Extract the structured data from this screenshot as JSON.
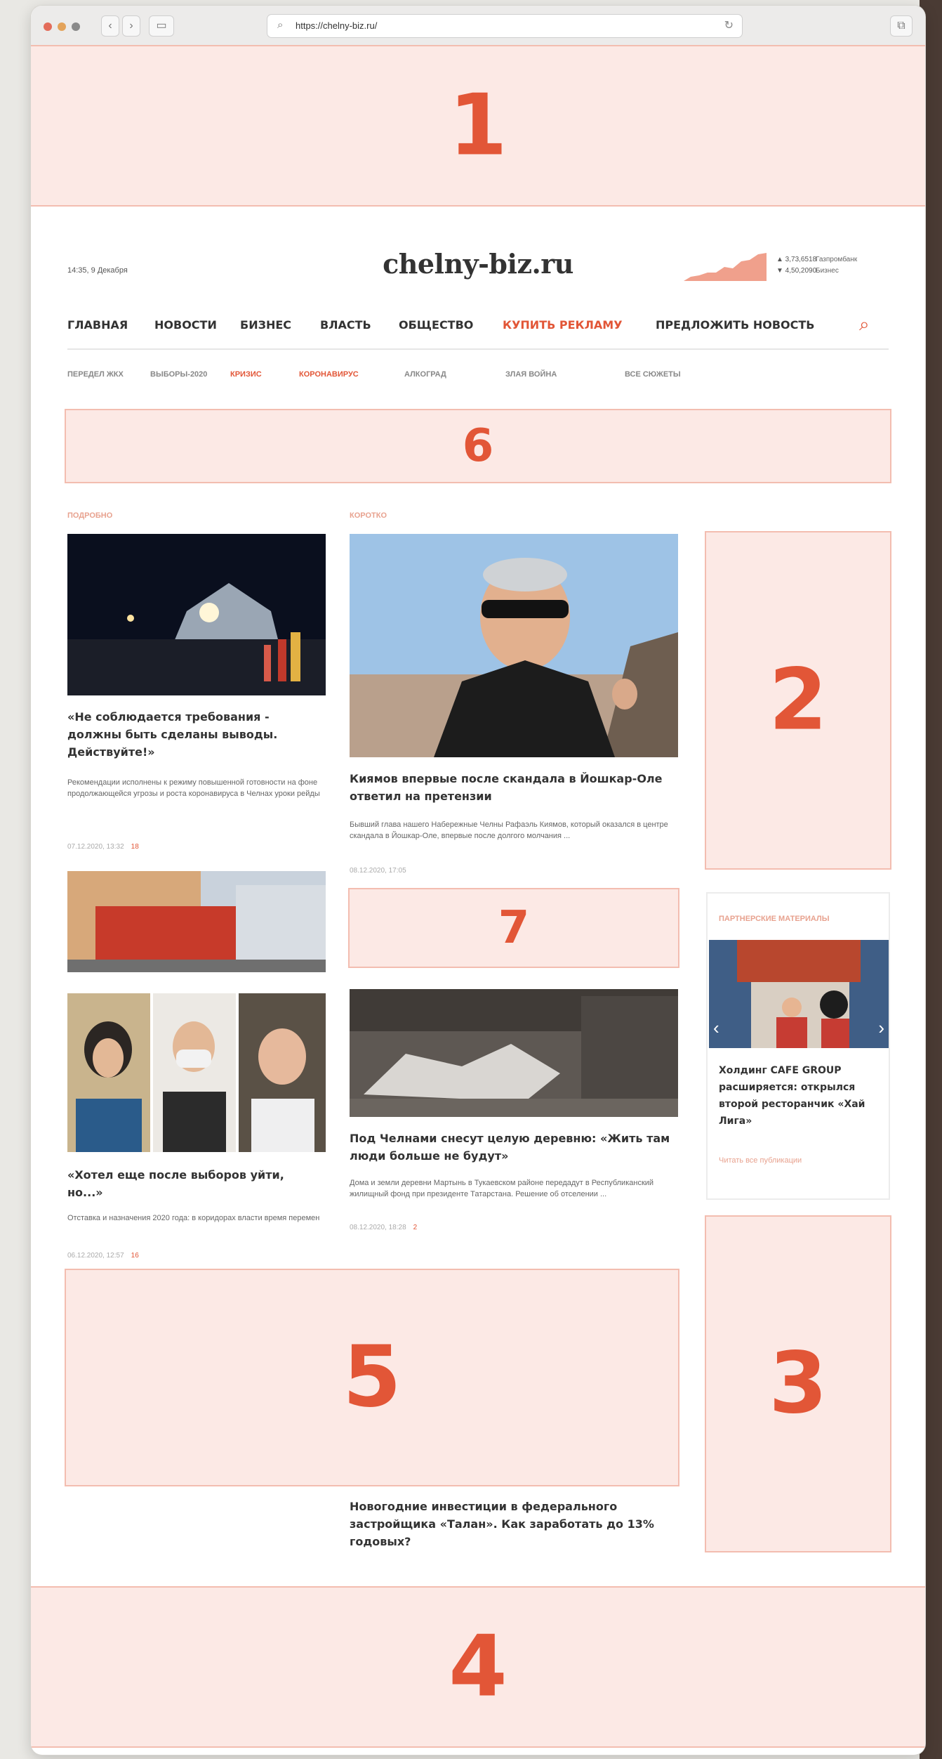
{
  "browser": {
    "url": "https://chelny-biz.ru/",
    "lock_icon": "search-icon",
    "reload_icon": "reload-icon"
  },
  "blocks": {
    "b1": "1",
    "b2": "2",
    "b3": "3",
    "b4": "4",
    "b5": "5",
    "b6": "6",
    "b7": "7"
  },
  "header": {
    "date": "14:35, 9 Декабря",
    "logo": "chelny-biz.ru",
    "rates": [
      "▲ 3,73,6518",
      "▼ 4,50,2090"
    ],
    "rate_labels": [
      "Газпромбанк",
      "Бизнес"
    ]
  },
  "nav": {
    "items": [
      "ГЛАВНАЯ",
      "НОВОСТИ",
      "БИЗНЕС",
      "ВЛАСТЬ",
      "ОБЩЕСТВО",
      "КУПИТЬ РЕКЛАМУ",
      "ПРЕДЛОЖИТЬ НОВОСТЬ"
    ],
    "highlight": "КУПИТЬ РЕКЛАМУ"
  },
  "subnav": {
    "items": [
      "ПЕРЕДЕЛ ЖКХ",
      "ВЫБОРЫ-2020",
      "КРИЗИС",
      "КОРОНАВИРУС",
      "АЛКОГРАД",
      "ЗЛАЯ ВОЙНА",
      "ВСЕ СЮЖЕТЫ"
    ]
  },
  "sections": {
    "left": "ПОДРОБНО",
    "mid": "КОРОТКО"
  },
  "articles": {
    "a1": {
      "headline": "«Не соблюдается требования - должны быть сделаны выводы. Действуйте!»",
      "lead": "Рекомендации исполнены к режиму повышенной готовности на фоне продолжающейся угрозы и роста коронавируса в Челнах уроки рейды",
      "date": "07.12.2020, 13:32",
      "comments": "18"
    },
    "a2": {
      "headline": "Киямов впервые после скандала в Йошкар-Оле ответил на претензии",
      "lead": "Бывший глава нашего Набережные Челны Рафаэль Киямов, который оказался в центре скандала в Йошкар-Оле, впервые после долгого молчания ...",
      "date": "08.12.2020, 17:05",
      "comments": ""
    },
    "a3": {
      "headline": "«Хотел еще после выборов уйти, но...»",
      "lead": "Отставка и назначения 2020 года: в коридорах власти время перемен",
      "date": "06.12.2020, 12:57",
      "comments": "16"
    },
    "a4": {
      "headline": "Под Челнами снесут целую деревню: «Жить там люди больше не будут»",
      "lead": "Дома и земли деревни Мартынь в Тукаевском районе передадут в Республиканский жилищный фонд при президенте Татарстана. Решение об отселении ...",
      "date": "08.12.2020, 18:28",
      "comments": "2"
    },
    "a5": {
      "headline": "Новогодние инвестиции в федерального застройщика «Талан». Как заработать до 13% годовых?"
    }
  },
  "partner": {
    "label": "ПАРТНЕРСКИЕ МАТЕРИАЛЫ",
    "headline": "Холдинг CAFE GROUP расширяется: открылся второй ресторанчик «Хай Лига»",
    "sub": "Читать все публикации"
  },
  "colors": {
    "accent": "#e25637",
    "ad_fill": "#fce9e5",
    "ad_border": "#f3bdb0"
  }
}
